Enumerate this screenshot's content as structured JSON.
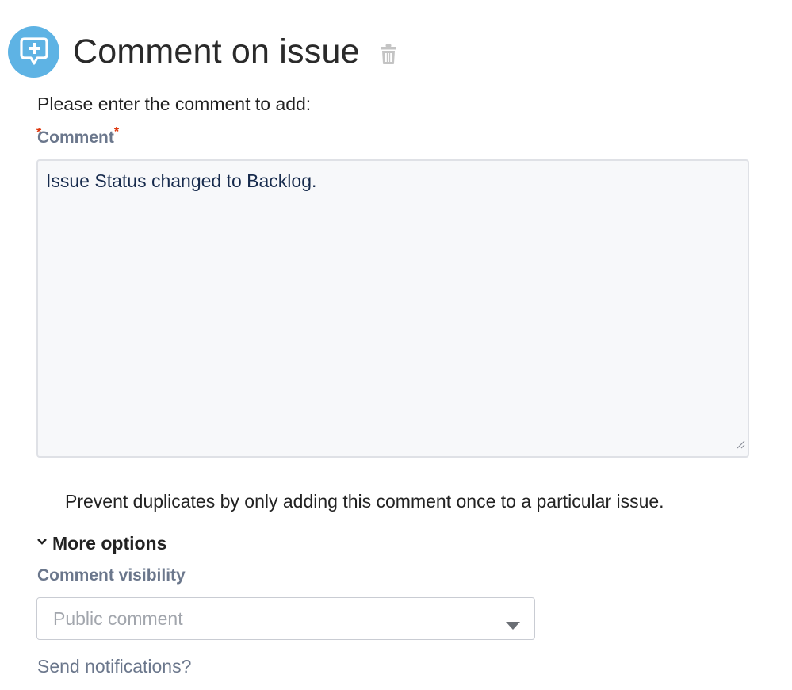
{
  "header": {
    "icon": "comment-add-icon",
    "title": "Comment on issue",
    "delete_icon": "trash-icon",
    "accent_color": "#5eb3e4"
  },
  "form": {
    "intro": "Please enter the comment to add:",
    "comment_label": "Comment",
    "required_marker": "*",
    "comment_value": "Issue Status changed to Backlog.",
    "duplicate_note": "Prevent duplicates by only adding this comment once to a particular issue."
  },
  "more_options": {
    "toggle_label": "More options",
    "toggle_icon": "chevron-down-icon",
    "visibility_label": "Comment visibility",
    "visibility_placeholder": "Public comment",
    "send_notifications_label": "Send notifications?"
  }
}
